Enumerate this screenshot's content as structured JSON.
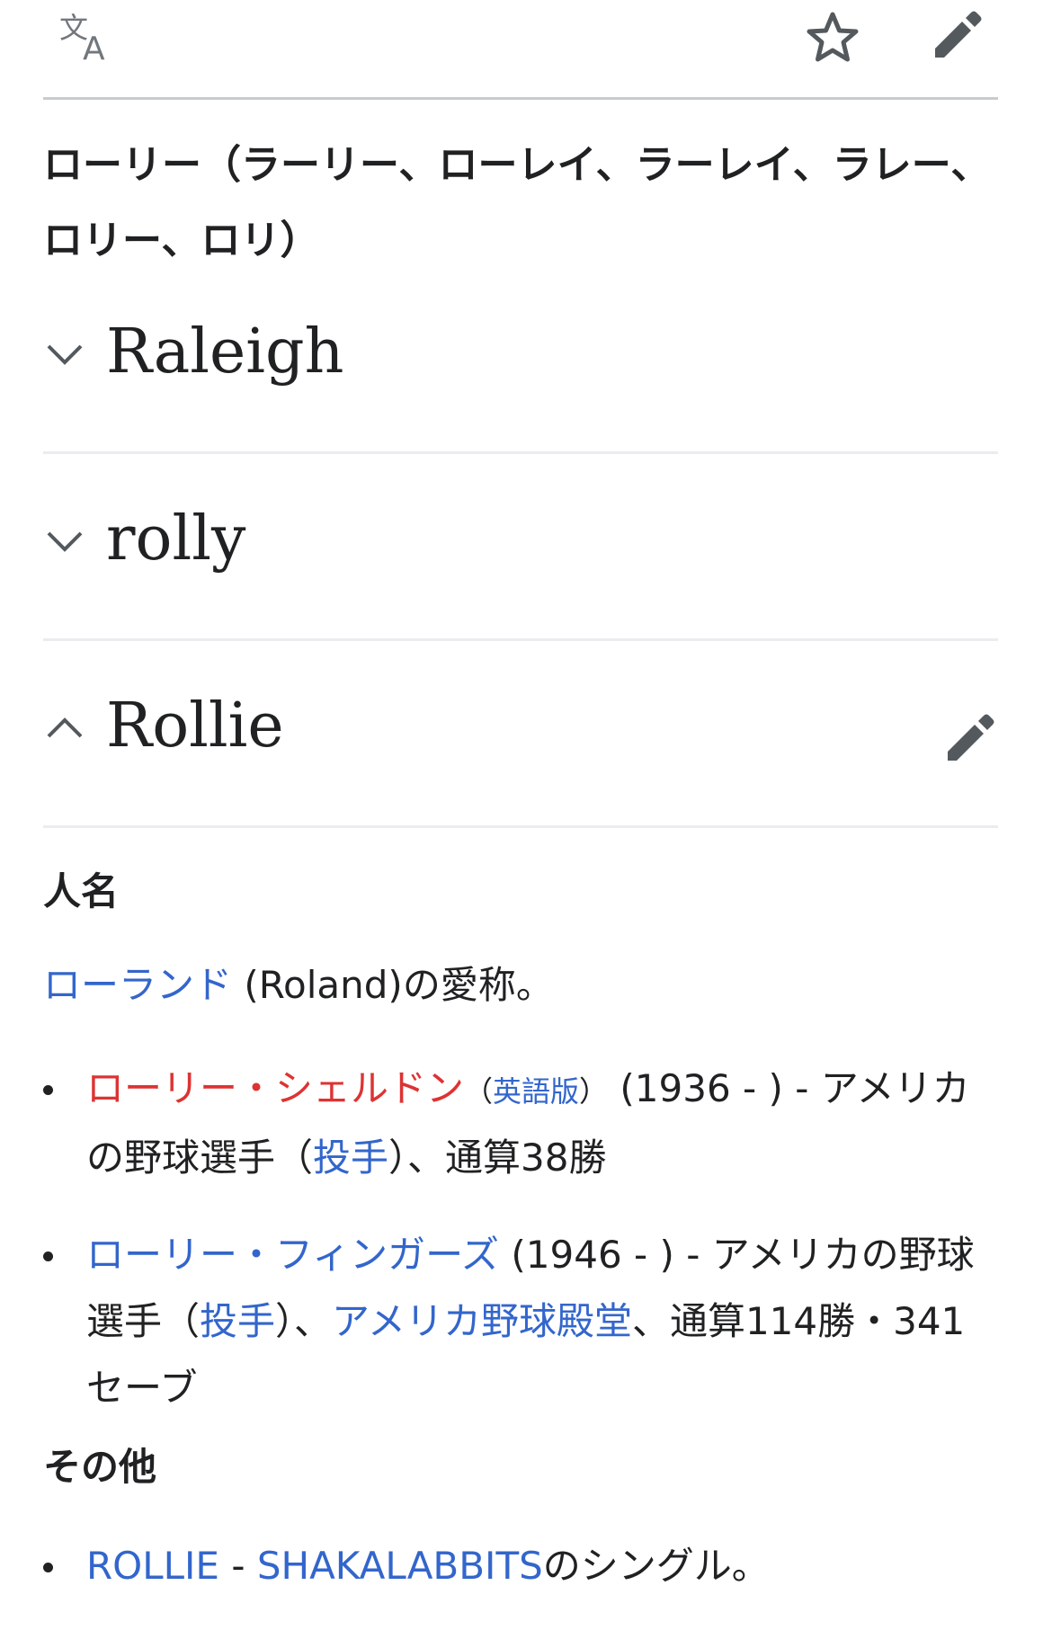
{
  "header": {
    "translate_icon": "translate-icon",
    "watch_icon": "star-icon",
    "edit_icon": "pencil-icon"
  },
  "lead": "ローリー（ラーリー、ローレイ、ラーレイ、ラレー、ロリー、ロリ）",
  "sections": [
    {
      "title": "Raleigh",
      "state": "collapsed",
      "chevron": "chevron-down-icon"
    },
    {
      "title": "rolly",
      "state": "collapsed",
      "chevron": "chevron-down-icon"
    },
    {
      "title": "Rollie",
      "state": "expanded",
      "chevron": "chevron-up-icon",
      "edit_icon": "pencil-icon"
    }
  ],
  "rollie": {
    "heading_person": "人名",
    "intro": {
      "link": "ローランド",
      "text": " (Roland)の愛称。"
    },
    "people": [
      {
        "name": "ローリー・シェルドン",
        "name_state": "redlink",
        "lang_open": "（",
        "lang_link": "英語版",
        "lang_close": "）",
        "text1": " (1936 - ) - アメリカの野球選手（",
        "link2": "投手",
        "text2": "）、通算38勝"
      },
      {
        "name": "ローリー・フィンガーズ",
        "text1": " (1946 - ) - アメリカの野球選手（",
        "link2": "投手",
        "text2": "）、",
        "link3": "アメリカ野球殿堂",
        "text3": "、通算114勝・341セーブ"
      }
    ],
    "heading_other": "その他",
    "other": [
      {
        "link1": "ROLLIE",
        "sep": " - ",
        "link2": "SHAKALABBITS",
        "text": "のシングル。"
      }
    ]
  },
  "colors": {
    "link": "#3366cc",
    "redlink": "#dd3333",
    "text": "#202122",
    "icon": "#54595d",
    "divider": "#c8ccd1"
  }
}
